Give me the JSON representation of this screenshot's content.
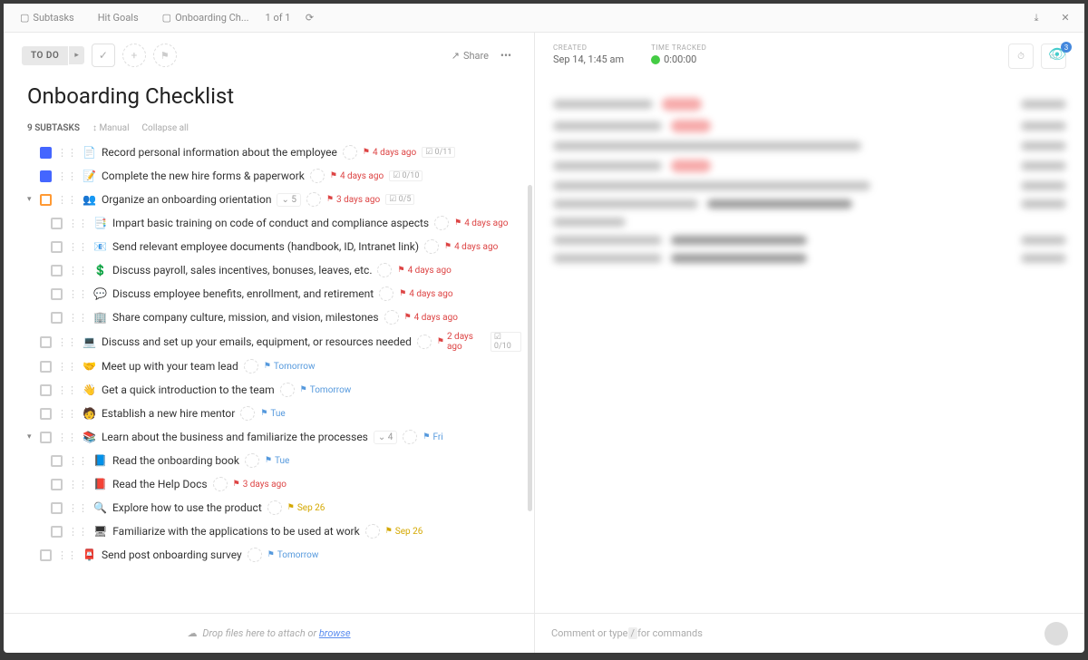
{
  "topbar": {
    "tab1": "Subtasks",
    "tab2": "Hit Goals",
    "tab3": "Onboarding Ch...",
    "pager": "1 of 1"
  },
  "header": {
    "status": "TO DO",
    "share": "Share"
  },
  "title": "Onboarding Checklist",
  "subtasks_header": {
    "count": "9 SUBTASKS",
    "manual": "Manual",
    "collapse": "Collapse all"
  },
  "tasks": [
    {
      "cbox": "blue",
      "emoji": "📄",
      "text": "Record personal information about the employee",
      "flag": "red",
      "due": "4 days ago",
      "prog": "0/11"
    },
    {
      "cbox": "blue",
      "emoji": "📝",
      "text": "Complete the new hire forms & paperwork",
      "flag": "red",
      "due": "4 days ago",
      "prog": "0/10"
    },
    {
      "cbox": "orange",
      "caret": true,
      "emoji": "👥",
      "text": "Organize an onboarding orientation",
      "subs": "5",
      "flag": "red",
      "due": "3 days ago",
      "prog": "0/5"
    },
    {
      "child": true,
      "emoji": "📑",
      "text": "Impart basic training on code of conduct and compliance aspects",
      "flag": "red",
      "due": "4 days ago"
    },
    {
      "child": true,
      "emoji": "📧",
      "text": "Send relevant employee documents (handbook, ID, Intranet link)",
      "flag": "red",
      "due": "4 days ago"
    },
    {
      "child": true,
      "emoji": "💲",
      "text": "Discuss payroll, sales incentives, bonuses, leaves, etc.",
      "flag": "red",
      "due": "4 days ago"
    },
    {
      "child": true,
      "emoji": "💬",
      "text": "Discuss employee benefits, enrollment, and retirement",
      "flag": "red",
      "due": "4 days ago"
    },
    {
      "child": true,
      "emoji": "🏢",
      "text": "Share company culture, mission, and vision, milestones",
      "flag": "red",
      "due": "4 days ago"
    },
    {
      "emoji": "💻",
      "text": "Discuss and set up your emails, equipment, or resources needed",
      "flag": "red",
      "due": "2 days ago",
      "prog": "0/10"
    },
    {
      "emoji": "🤝",
      "text": "Meet up with your team lead",
      "flag": "blue",
      "due": "Tomorrow"
    },
    {
      "emoji": "👋",
      "text": "Get a quick introduction to the team",
      "flag": "blue",
      "due": "Tomorrow"
    },
    {
      "emoji": "🧑",
      "text": "Establish a new hire mentor",
      "flag": "blue",
      "due": "Tue"
    },
    {
      "caret": true,
      "emoji": "📚",
      "text": "Learn about the business and familiarize the processes",
      "subs": "4",
      "flag": "blue",
      "due": "Fri"
    },
    {
      "child": true,
      "emoji": "📘",
      "text": "Read the onboarding book",
      "flag": "blue",
      "due": "Tue"
    },
    {
      "child": true,
      "emoji": "📕",
      "text": "Read the Help Docs",
      "flag": "red",
      "due": "3 days ago"
    },
    {
      "child": true,
      "emoji": "🔍",
      "text": "Explore how to use the product",
      "flag": "yellow",
      "due": "Sep 26"
    },
    {
      "child": true,
      "emoji": "🖥",
      "text": "Familiarize with the applications to be used at work",
      "flag": "yellow",
      "due": "Sep 26"
    },
    {
      "emoji": "📮",
      "text": "Send post onboarding survey",
      "flag": "blue",
      "due": "Tomorrow"
    }
  ],
  "meta": {
    "created_lbl": "CREATED",
    "created": "Sep 14, 1:45 am",
    "tracked_lbl": "TIME TRACKED",
    "tracked": "0:00:00"
  },
  "eye_count": "3",
  "footer": {
    "drop": "Drop files here to attach or ",
    "browse": "browse",
    "comment": "Comment or type ",
    "slash": "/",
    "commands": " for commands"
  }
}
